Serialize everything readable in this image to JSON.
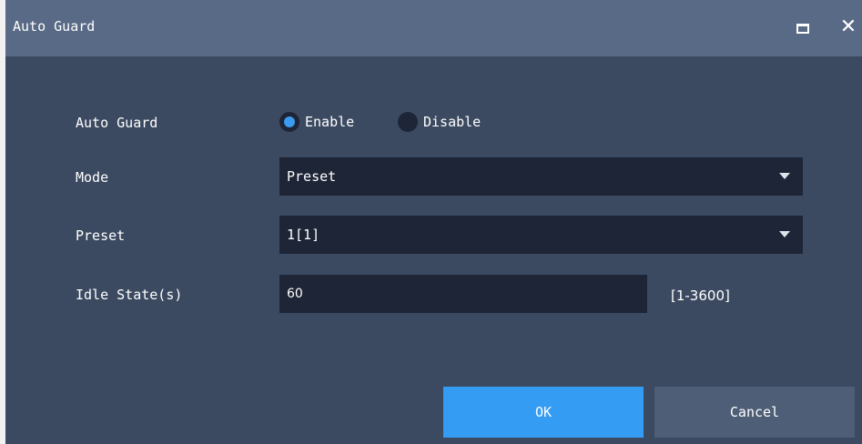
{
  "window": {
    "title": "Auto Guard"
  },
  "form": {
    "auto_guard": {
      "label": "Auto Guard",
      "options": [
        {
          "label": "Enable",
          "checked": true
        },
        {
          "label": "Disable",
          "checked": false
        }
      ]
    },
    "mode": {
      "label": "Mode",
      "value": "Preset"
    },
    "preset": {
      "label": "Preset",
      "value": "1[1]"
    },
    "idle_state": {
      "label": "Idle State(s)",
      "value": "60",
      "range_hint": "[1-3600]"
    }
  },
  "footer": {
    "ok_label": "OK",
    "cancel_label": "Cancel"
  },
  "colors": {
    "accent": "#359cf3",
    "background": "#3c4a61",
    "titlebar": "#586a85",
    "field": "#1d2536"
  }
}
